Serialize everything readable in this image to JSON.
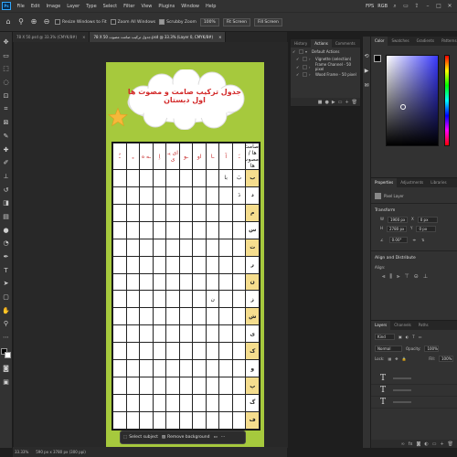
{
  "menubar": {
    "app_logo": "Ps",
    "items": [
      "File",
      "Edit",
      "Image",
      "Layer",
      "Type",
      "Select",
      "Filter",
      "View",
      "Plugins",
      "Window",
      "Help"
    ],
    "right": {
      "fps": "FPS",
      "mode": "RGB"
    }
  },
  "options": {
    "resize_windows": "Resize Windows to Fit",
    "zoom_all": "Zoom All Windows",
    "scrubby_zoom": "Scrubby Zoom",
    "zoom_pct": "100%",
    "fit_screen": "Fit Screen",
    "fill_screen": "Fill Screen"
  },
  "doc_tabs": [
    {
      "label": "78 X 50.psd @ 33.3% (CMYK/8#)"
    },
    {
      "label": "78 X 50 جدول ترکیب صامت مصوت.psd @ 33.3% (Layer 0, CMYK/8#)"
    }
  ],
  "document": {
    "title": "جدول ترکیب صامت و مصوت ها اول دبستان",
    "corner_label": "صامت ها / مصوت ها",
    "header_vowels": [
      "ـَ",
      "آ",
      "ـا",
      "او",
      "ـو",
      "ای یـ ی",
      "اِ",
      "ـه ه",
      "ـِ",
      "ـُ"
    ],
    "rows": [
      {
        "lead": "ب",
        "cells": [
          "بَ",
          "با",
          "",
          "",
          "",
          "",
          "",
          "",
          "",
          ""
        ]
      },
      {
        "lead": "د",
        "cells": [
          "دَ",
          "",
          "",
          "",
          "",
          "",
          "",
          "",
          "",
          ""
        ]
      },
      {
        "lead": "م",
        "cells": [
          "",
          "",
          "",
          "",
          "",
          "",
          "",
          "",
          "",
          ""
        ]
      },
      {
        "lead": "س",
        "cells": [
          "",
          "",
          "",
          "",
          "",
          "",
          "",
          "",
          "",
          ""
        ]
      },
      {
        "lead": "ت",
        "cells": [
          "",
          "",
          "",
          "",
          "",
          "",
          "",
          "",
          "",
          ""
        ]
      },
      {
        "lead": "ر",
        "cells": [
          "",
          "",
          "",
          "",
          "",
          "",
          "",
          "",
          "",
          ""
        ]
      },
      {
        "lead": "ن",
        "cells": [
          "",
          "",
          "",
          "",
          "",
          "",
          "",
          "",
          "",
          ""
        ]
      },
      {
        "lead": "ز",
        "cells": [
          "",
          "",
          "ن",
          "",
          "",
          "",
          "",
          "",
          "",
          ""
        ]
      },
      {
        "lead": "ش",
        "cells": [
          "",
          "",
          "",
          "",
          "",
          "",
          "",
          "",
          "",
          ""
        ]
      },
      {
        "lead": "ی",
        "cells": [
          "",
          "",
          "",
          "",
          "",
          "",
          "",
          "",
          "",
          ""
        ]
      },
      {
        "lead": "ک",
        "cells": [
          "",
          "",
          "",
          "",
          "",
          "",
          "",
          "",
          "",
          ""
        ]
      },
      {
        "lead": "و",
        "cells": [
          "",
          "",
          "",
          "",
          "",
          "",
          "",
          "",
          "",
          ""
        ]
      },
      {
        "lead": "پ",
        "cells": [
          "",
          "",
          "",
          "",
          "",
          "",
          "",
          "",
          "",
          ""
        ]
      },
      {
        "lead": "گ",
        "cells": [
          "",
          "",
          "",
          "",
          "",
          "",
          "",
          "",
          "",
          ""
        ]
      },
      {
        "lead": "ف",
        "cells": [
          "",
          "",
          "",
          "",
          "",
          "",
          "",
          "",
          "",
          ""
        ]
      }
    ]
  },
  "context_bar": {
    "select_subject": "Select subject",
    "remove_background": "Remove background"
  },
  "status": {
    "zoom": "33.33%",
    "size": "590 px x 3780 px (300 ppi)"
  },
  "actions_panel": {
    "tabs": [
      "History",
      "Actions",
      "Comments"
    ],
    "items": [
      {
        "label": "Default Actions",
        "level": 0
      },
      {
        "label": "Vignette (selection)",
        "level": 1
      },
      {
        "label": "Frame Channel - 50 pixel",
        "level": 1
      },
      {
        "label": "Wood Frame - 50 pixel",
        "level": 1
      }
    ]
  },
  "color_panel": {
    "tabs": [
      "Color",
      "Swatches",
      "Gradients",
      "Patterns"
    ]
  },
  "properties": {
    "tabs": [
      "Properties",
      "Adjustments",
      "Libraries"
    ],
    "layer_type": "Pixel Layer",
    "transform_title": "Transform",
    "w": "1900 px",
    "h": "2780 px",
    "x": "0 px",
    "y": "0 px",
    "angle": "0.00°",
    "align_title": "Align and Distribute",
    "align_label": "Align:"
  },
  "layers": {
    "tabs": [
      "Layers",
      "Channels",
      "Paths"
    ],
    "kind": "Kind",
    "blend": "Normal",
    "opacity_label": "Opacity:",
    "opacity": "100%",
    "lock_label": "Lock:",
    "fill_label": "Fill:",
    "fill": "100%"
  }
}
